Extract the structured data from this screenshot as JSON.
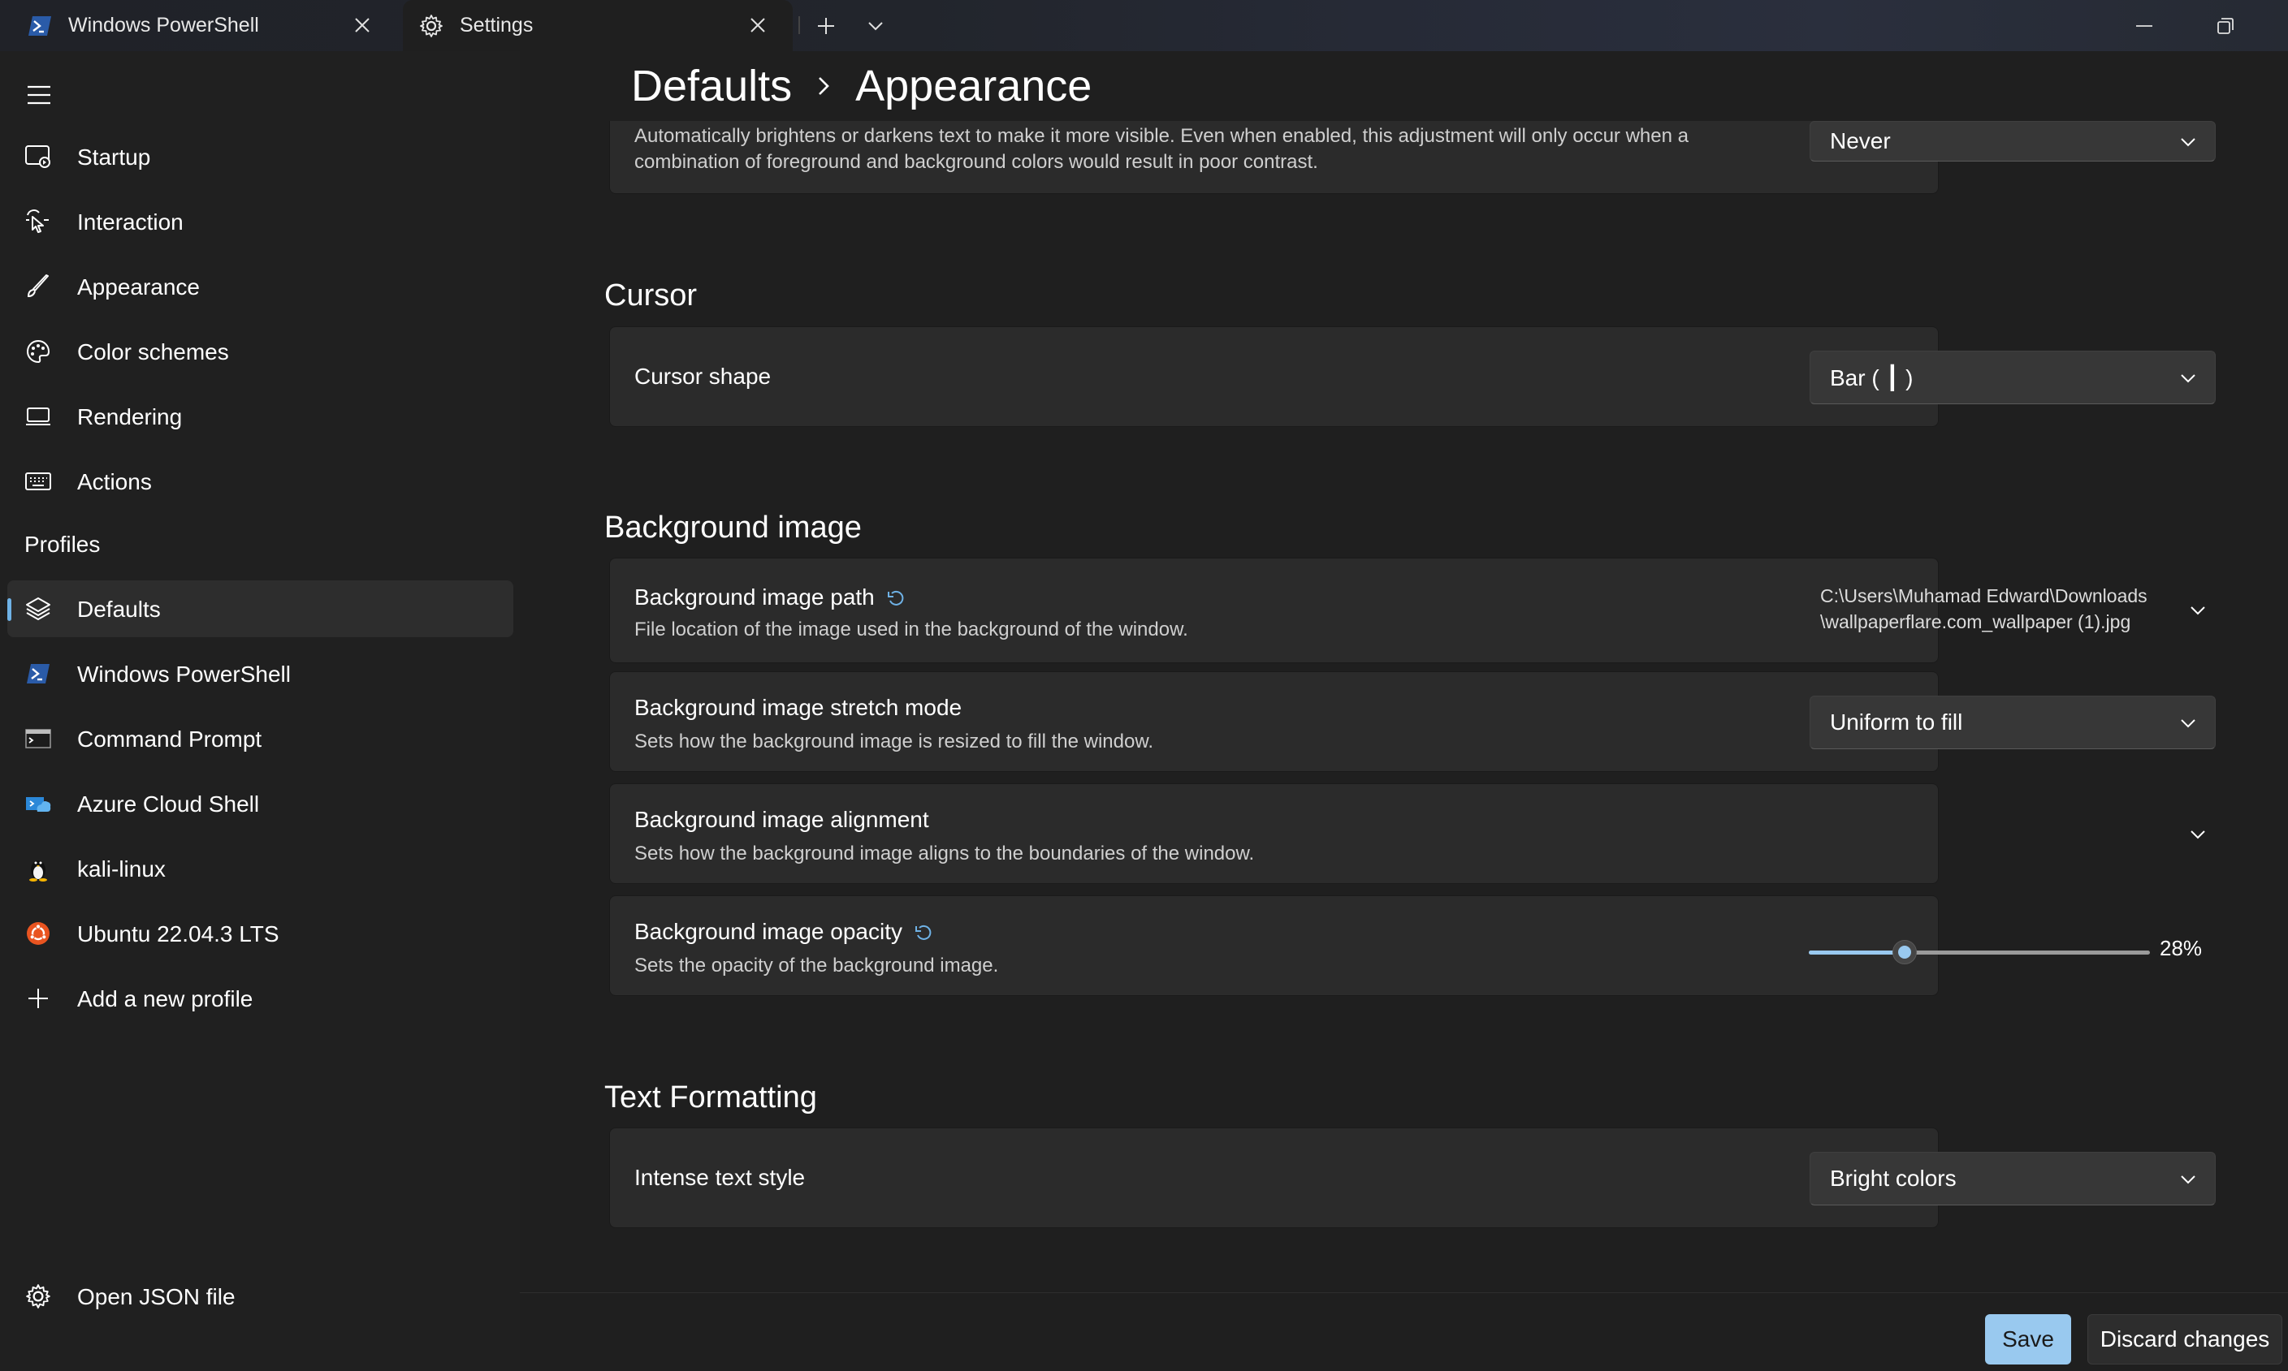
{
  "tabs": [
    {
      "label": "Windows PowerShell",
      "icon": "powershell-icon"
    },
    {
      "label": "Settings",
      "icon": "gear-icon"
    }
  ],
  "sidebar": {
    "items": [
      {
        "label": "Startup",
        "icon": "startup-icon"
      },
      {
        "label": "Interaction",
        "icon": "interaction-icon"
      },
      {
        "label": "Appearance",
        "icon": "paintbrush-icon"
      },
      {
        "label": "Color schemes",
        "icon": "palette-icon"
      },
      {
        "label": "Rendering",
        "icon": "monitor-icon"
      },
      {
        "label": "Actions",
        "icon": "keyboard-icon"
      }
    ],
    "profiles_header": "Profiles",
    "profiles": [
      {
        "label": "Defaults",
        "icon": "layers-icon",
        "selected": true
      },
      {
        "label": "Windows PowerShell",
        "icon": "powershell-icon"
      },
      {
        "label": "Command Prompt",
        "icon": "cmd-icon"
      },
      {
        "label": "Azure Cloud Shell",
        "icon": "azure-icon"
      },
      {
        "label": "kali-linux",
        "icon": "linux-penguin-icon"
      },
      {
        "label": "Ubuntu 22.04.3 LTS",
        "icon": "ubuntu-icon"
      },
      {
        "label": "Add a new profile",
        "icon": "plus-icon"
      }
    ],
    "open_json": {
      "label": "Open JSON file",
      "icon": "gear-icon"
    }
  },
  "breadcrumb": {
    "parent": "Defaults",
    "current": "Appearance"
  },
  "contrast": {
    "desc_line1": "Automatically brightens or darkens text to make it more visible. Even when enabled, this adjustment will only occur when a",
    "desc_line2": "combination of foreground and background colors would result in poor contrast.",
    "value": "Never"
  },
  "cursor": {
    "section": "Cursor",
    "shape_title": "Cursor shape",
    "shape_value": "Bar ( ┃ )"
  },
  "background_image": {
    "section": "Background image",
    "path_title": "Background image path",
    "path_desc": "File location of the image used in the background of the window.",
    "path_value_line1": "C:\\Users\\Muhamad Edward\\Downloads",
    "path_value_line2": "\\wallpaperflare.com_wallpaper (1).jpg",
    "stretch_title": "Background image stretch mode",
    "stretch_desc": "Sets how the background image is resized to fill the window.",
    "stretch_value": "Uniform to fill",
    "alignment_title": "Background image alignment",
    "alignment_desc": "Sets how the background image aligns to the boundaries of the window.",
    "opacity_title": "Background image opacity",
    "opacity_desc": "Sets the opacity of the background image.",
    "opacity_value": 28,
    "opacity_label": "28%"
  },
  "text_formatting": {
    "section": "Text Formatting",
    "intense_title": "Intense text style",
    "intense_value": "Bright colors"
  },
  "footer": {
    "save": "Save",
    "discard": "Discard changes"
  },
  "colors": {
    "accent": "#99c9ef",
    "background": "#1f1f1f",
    "card": "#2b2b2b"
  }
}
